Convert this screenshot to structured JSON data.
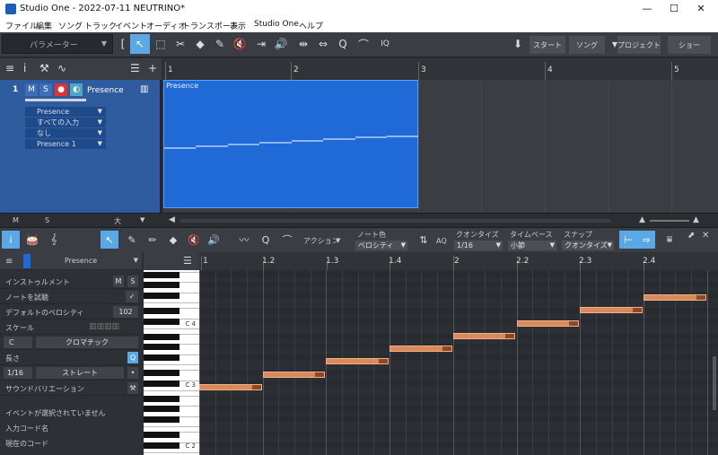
{
  "window": {
    "title": "Studio One - 2022-07-11 NEUTRINO*",
    "minimize": "—",
    "maximize": "☐",
    "close": "✕"
  },
  "menu": [
    "ファイル",
    "編集",
    "ソング",
    "トラック",
    "イベント",
    "オーディオ",
    "トランスポート",
    "表示",
    "Studio One",
    "ヘルプ"
  ],
  "toolbar": {
    "param_label": "パラメーター",
    "iq_label": "IQ",
    "start_label": "スタート",
    "song_label": "ソング",
    "project_label": "プロジェクト",
    "show_label": "ショー"
  },
  "ruler_top": [
    "1",
    "2",
    "3",
    "4",
    "5"
  ],
  "track": {
    "number": "1",
    "mute": "M",
    "solo": "S",
    "name": "Presence",
    "instrument": "Presence",
    "input": "すべての入力",
    "channel": "なし",
    "output": "Presence 1"
  },
  "event": {
    "label": "Presence"
  },
  "arrange_bottom": {
    "m": "M",
    "s": "S",
    "size": "大"
  },
  "editor": {
    "action_label": "アクション",
    "note_color_label": "ノート色",
    "note_color_value": "ベロシティ",
    "aq_label": "AQ",
    "quantize_label": "クオンタイズ",
    "quantize_value": "1/16",
    "timebase_label": "タイムベース",
    "timebase_value": "小節",
    "snap_label": "スナップ",
    "snap_value": "クオンタイズ"
  },
  "inspector": {
    "track_name": "Presence",
    "instrument_label": "インストゥルメント",
    "mute": "M",
    "solo": "S",
    "note_audition_label": "ノートを試聴",
    "default_velocity_label": "デフォルトのベロシティ",
    "default_velocity_value": "102",
    "scale_label": "スケール",
    "scale_root": "C",
    "scale_type": "クロマチック",
    "length_label": "長さ",
    "length_value": "1/16",
    "length_mode": "ストレート",
    "sound_variation_label": "サウンドバリエーション",
    "no_event_label": "イベントが選択されていません",
    "input_chord_label": "入力コード名",
    "current_chord_label": "現在のコード"
  },
  "keyboard_labels": {
    "c4": "C 4",
    "c3": "C 3",
    "c2": "C 2"
  },
  "piano_ruler": [
    "1",
    "1.2",
    "1.3",
    "1.4",
    "2",
    "2.2",
    "2.3",
    "2.4"
  ],
  "colors": {
    "selection_blue": "#5aa9e6",
    "event_blue": "#1f6ad6",
    "note_orange": "#d9895a",
    "record_red": "#e53030"
  },
  "chart_data": {
    "type": "piano-roll",
    "notes": [
      {
        "start_beat": 1.0,
        "length_beats": 1.0
      },
      {
        "start_beat": 2.0,
        "length_beats": 1.0
      },
      {
        "start_beat": 3.0,
        "length_beats": 1.0
      },
      {
        "start_beat": 4.0,
        "length_beats": 1.0
      },
      {
        "start_beat": 5.0,
        "length_beats": 1.0
      },
      {
        "start_beat": 6.0,
        "length_beats": 1.0
      },
      {
        "start_beat": 7.0,
        "length_beats": 1.0
      },
      {
        "start_beat": 8.0,
        "length_beats": 1.0
      }
    ]
  }
}
